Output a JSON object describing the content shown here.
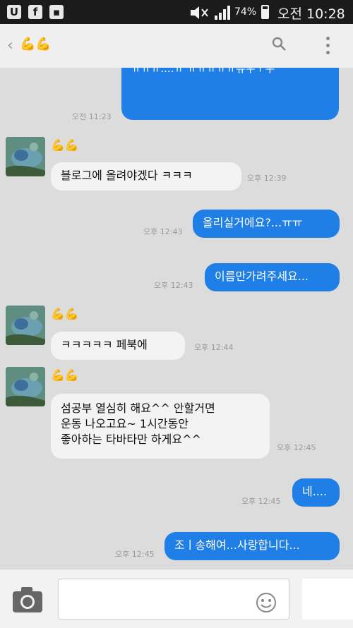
{
  "status_bar": {
    "signal_text": "74%",
    "time": "오전 10:28",
    "battery_level_percent": 74,
    "icons": [
      "u-plus-icon",
      "facebook-icon",
      "image-icon",
      "wifi-icon",
      "mute-icon",
      "signal-icon",
      "battery-icon"
    ]
  },
  "header": {
    "back_glyph": "‹",
    "nickname_emoji": "💪💪"
  },
  "messages": [
    {
      "side": "out",
      "text": "대답 늦어서 죄송해요 밥 먹고 와서 보내서 죄송해요.....선생님 진짜 죄송해요.....ㅠㅠㅠㅠㅠㅠ....ㅠ ㅠㅠㅠㅠㅠ유우ㅜ우",
      "time": "오전 11:23"
    },
    {
      "side": "in",
      "text": "블로그에 올려야겠다 ㅋㅋㅋ",
      "time": "오후 12:39"
    },
    {
      "side": "out",
      "text": "올리실거에요?...ㅠㅠ",
      "time": "오후 12:43"
    },
    {
      "side": "out",
      "text": "이름만가려주세요...",
      "time": "오후 12:43"
    },
    {
      "side": "in",
      "text": "ㅋㅋㅋㅋㅋ 페북에",
      "time": "오후 12:44"
    },
    {
      "side": "in",
      "text": "섬공부 열심히 해요^^ 안할거면\n운동 나오고요~  1시간동안\n좋아하는 타바타만 하게요^^",
      "time": "오후 12:45"
    },
    {
      "side": "out",
      "text": "네....",
      "time": "오후 12:45"
    },
    {
      "side": "out",
      "text": "조ㅣ송해여...사랑합니다...",
      "time": "오후 12:45"
    }
  ],
  "sender_nickname": "💪💪",
  "input_bar": {
    "placeholder": ""
  },
  "colors": {
    "outgoing_bubble": "#1f7fe6",
    "incoming_bubble": "#f3f3f3",
    "chat_background": "#dcdcdc"
  }
}
